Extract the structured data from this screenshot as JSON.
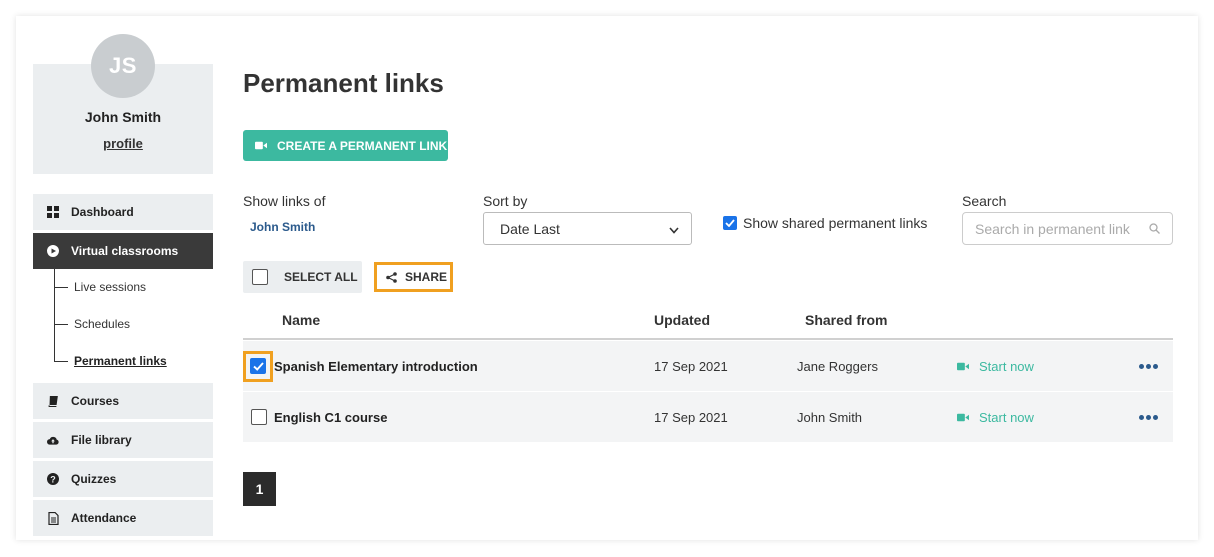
{
  "user": {
    "initials": "JS",
    "name": "John Smith",
    "profile_link": "profile"
  },
  "nav": {
    "dashboard": "Dashboard",
    "virtual_classrooms": "Virtual classrooms",
    "live_sessions": "Live sessions",
    "schedules": "Schedules",
    "permanent_links": "Permanent links",
    "courses": "Courses",
    "file_library": "File library",
    "quizzes": "Quizzes",
    "attendance": "Attendance"
  },
  "page": {
    "title": "Permanent links",
    "create_button": "CREATE A PERMANENT LINK"
  },
  "filters": {
    "show_links_of_label": "Show links of",
    "show_links_of_value": "John Smith",
    "sort_by_label": "Sort by",
    "sort_by_value": "Date Last",
    "show_shared_label": "Show shared permanent links",
    "show_shared_checked": true,
    "search_label": "Search",
    "search_placeholder": "Search in permanent link"
  },
  "actions": {
    "select_all": "SELECT ALL",
    "share": "SHARE"
  },
  "table": {
    "headers": {
      "name": "Name",
      "updated": "Updated",
      "shared_from": "Shared from"
    },
    "rows": [
      {
        "checked": true,
        "name": "Spanish Elementary introduction",
        "updated": "17 Sep 2021",
        "shared_from": "Jane Roggers",
        "action": "Start now"
      },
      {
        "checked": false,
        "name": "English C1 course",
        "updated": "17 Sep 2021",
        "shared_from": "John Smith",
        "action": "Start now"
      }
    ]
  },
  "pagination": {
    "current_page": "1"
  },
  "colors": {
    "accent_green": "#3cb9a0",
    "link_blue": "#2b5a8c",
    "highlight_orange": "#f0a020",
    "checkbox_blue": "#1a73e8"
  }
}
